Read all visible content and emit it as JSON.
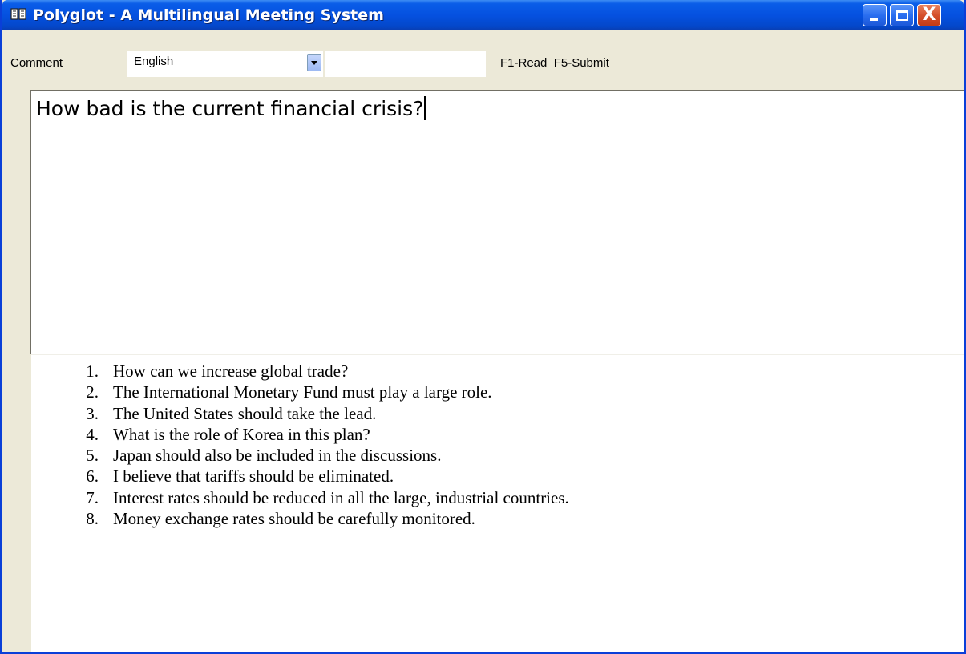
{
  "window": {
    "title": "Polyglot - A Multilingual Meeting System",
    "app_icon": "book-icon",
    "controls": [
      "minimize-icon",
      "maximize-icon",
      "close-icon"
    ],
    "close_glyph": "X"
  },
  "toolbar": {
    "comment_label": "Comment",
    "language_selected": "English",
    "text_field_value": "",
    "hotkeys": "F1-Read  F5-Submit"
  },
  "editor": {
    "text": "How bad is the current financial crisis?"
  },
  "list": [
    {
      "num": "1.",
      "text": "How can we increase global trade?"
    },
    {
      "num": "2.",
      "text": "The International Monetary Fund must play a large role."
    },
    {
      "num": "3.",
      "text": "The United States should take the lead."
    },
    {
      "num": "4.",
      "text": "What is the role of Korea in this plan?"
    },
    {
      "num": "5.",
      "text": "Japan should also be included in the discussions."
    },
    {
      "num": "6.",
      "text": "I believe that tariffs should be eliminated."
    },
    {
      "num": "7.",
      "text": "Interest rates should be reduced in all the large, industrial countries."
    },
    {
      "num": "8.",
      "text": "Money exchange rates should be carefully monitored."
    }
  ],
  "colors": {
    "titlebar": "#0551e0",
    "chrome": "#ece9d8",
    "close_button": "#d5502b"
  }
}
